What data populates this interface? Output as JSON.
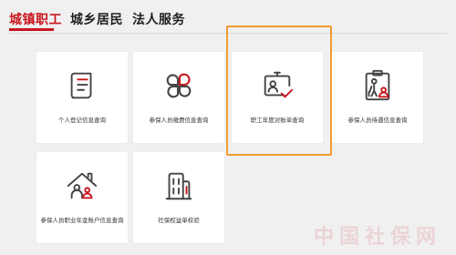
{
  "tabs": [
    {
      "label": "城镇职工",
      "active": true
    },
    {
      "label": "城乡居民",
      "active": false
    },
    {
      "label": "法人服务",
      "active": false
    }
  ],
  "cards": [
    {
      "label": "个人登记信息查询",
      "icon": "document-icon"
    },
    {
      "label": "参保人员缴费信息查询",
      "icon": "clover-icon"
    },
    {
      "label": "职工年度对账单查询",
      "icon": "id-badge-check-icon"
    },
    {
      "label": "参保人员待遇信息查询",
      "icon": "clipboard-elder-icon"
    },
    {
      "label": "参保人员职业年金账户信息查询",
      "icon": "house-family-icon"
    },
    {
      "label": "社保权益单校验",
      "icon": "building-icon"
    }
  ],
  "watermark": "中国社保网",
  "colors": {
    "accent": "#c8161d",
    "highlight": "#f39a35",
    "icon_stroke": "#444444"
  }
}
